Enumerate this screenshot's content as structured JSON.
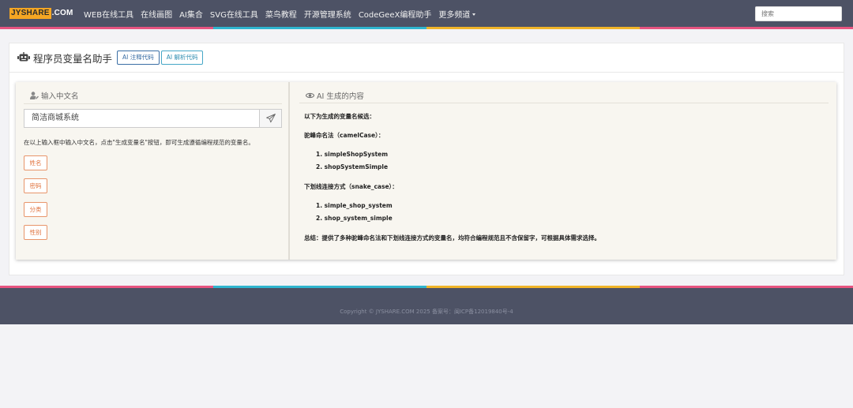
{
  "header": {
    "logo_part1": "JYSHARE",
    "logo_part2": ".COM",
    "nav": [
      {
        "label": "WEB在线工具"
      },
      {
        "label": "在线画图"
      },
      {
        "label": "AI集合"
      },
      {
        "label": "SVG在线工具"
      },
      {
        "label": "菜鸟教程"
      },
      {
        "label": "开源管理系统"
      },
      {
        "label": "CodeGeeX编程助手"
      },
      {
        "label": "更多频道",
        "dropdown": true
      }
    ],
    "search_placeholder": "搜索"
  },
  "rainbow_colors": [
    "#e75480",
    "#2fb5cf",
    "#f0b429",
    "#e75480"
  ],
  "page": {
    "title": "程序员变量名助手",
    "title_icon": "robot-icon",
    "buttons": {
      "comment_code": "AI 注释代码",
      "parse_code": "AI 解析代码"
    }
  },
  "input_panel": {
    "heading": "输入中文名",
    "heading_icon": "user-edit-icon",
    "input_value": "简洁商城系统",
    "send_icon": "paper-plane-icon",
    "hint": "在以上输入框中输入中文名，点击\"生成变量名\"按钮，即可生成遵循编程规范的变量名。",
    "tags": [
      "姓名",
      "密码",
      "分类",
      "性别"
    ]
  },
  "output_panel": {
    "heading": "AI 生成的内容",
    "heading_icon": "eye-icon",
    "intro": "以下为生成的变量名候选：",
    "camel_heading": "驼峰命名法（camelCase）：",
    "camel_items": [
      "1. simpleShopSystem",
      "2. shopSystemSimple"
    ],
    "snake_heading": "下划线连接方式（snake_case）：",
    "snake_items": [
      "1. simple_shop_system",
      "2. shop_system_simple"
    ],
    "summary": "总结：提供了多种驼峰命名法和下划线连接方式的变量名，均符合编程规范且不含保留字，可根据具体需求选择。"
  },
  "footer": {
    "text": "Copyright © JYSHARE.COM 2025 备案号：闽ICP备12019840号-4"
  }
}
